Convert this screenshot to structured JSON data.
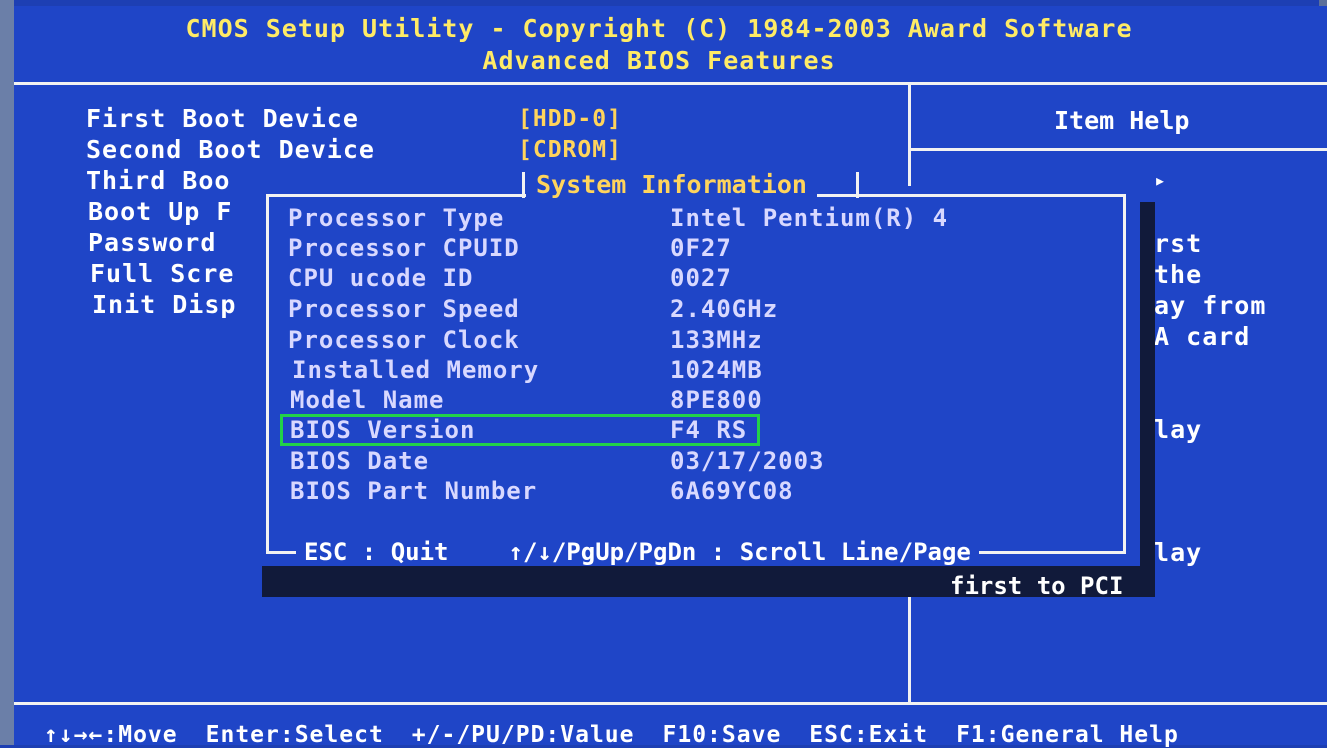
{
  "header": {
    "title": "CMOS Setup Utility - Copyright (C) 1984-2003 Award Software",
    "subtitle": "Advanced BIOS Features"
  },
  "menu": {
    "items": [
      {
        "label": "First Boot Device",
        "value": "[HDD-0]"
      },
      {
        "label": "Second Boot Device",
        "value": "[CDROM]"
      },
      {
        "label": "Third Boo",
        "value": ""
      },
      {
        "label": "Boot Up F",
        "value": ""
      },
      {
        "label": "Password",
        "value": ""
      },
      {
        "label": "Full Scre",
        "value": ""
      },
      {
        "label": "Init Disp",
        "value": ""
      }
    ]
  },
  "help": {
    "title": "Item Help",
    "fragments": [
      "▸",
      "irst",
      "the",
      "lay from",
      "GA card",
      "play",
      "play"
    ],
    "below_popup": "first to PCI"
  },
  "popup": {
    "title": "System Information",
    "rows": [
      {
        "label": "Processor Type",
        "value": "Intel Pentium(R) 4"
      },
      {
        "label": "Processor CPUID",
        "value": "0F27"
      },
      {
        "label": "CPU ucode ID",
        "value": "0027"
      },
      {
        "label": "Processor Speed",
        "value": "2.40GHz"
      },
      {
        "label": "Processor Clock",
        "value": "133MHz"
      },
      {
        "label": "Installed Memory",
        "value": "1024MB"
      },
      {
        "label": "Model Name",
        "value": "8PE800"
      },
      {
        "label": "BIOS Version",
        "value": "F4 RS"
      },
      {
        "label": "BIOS Date",
        "value": "03/17/2003"
      },
      {
        "label": "BIOS Part Number",
        "value": "6A69YC08"
      }
    ],
    "footer_quit": "ESC : Quit",
    "footer_scroll": "↑/↓/PgUp/PgDn : Scroll Line/Page"
  },
  "bottom_bar": {
    "move": "↑↓→←:Move",
    "select": "Enter:Select",
    "value": "+/-/PU/PD:Value",
    "save": "F10:Save",
    "exit": "ESC:Exit",
    "help": "F1:General Help"
  },
  "colors": {
    "background": "#1f45c7",
    "title": "#ffeb66",
    "value": "#ffd45c",
    "highlight_box": "#22d24a"
  }
}
